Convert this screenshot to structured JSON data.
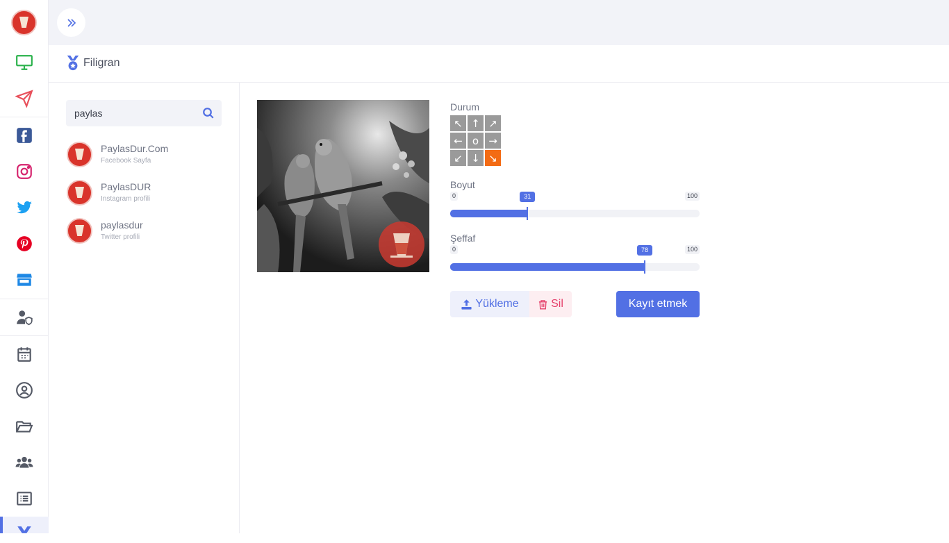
{
  "header": {
    "page_title": "Filigran"
  },
  "search": {
    "value": "paylas",
    "placeholder": ""
  },
  "accounts": [
    {
      "name": "PaylasDur.Com",
      "type": "Facebook Sayfa"
    },
    {
      "name": "PaylasDUR",
      "type": "Instagram profili"
    },
    {
      "name": "paylasdur",
      "type": "Twitter profili"
    }
  ],
  "controls": {
    "position_label": "Durum",
    "position_grid": [
      "↖",
      "↑",
      "↗",
      "←",
      "o",
      "→",
      "↙",
      "↓",
      "↘"
    ],
    "selected_position": "bottom-right",
    "size_label": "Boyut",
    "size": {
      "min": "0",
      "max": "100",
      "value": "31"
    },
    "opacity_label": "Şeffaf",
    "opacity": {
      "min": "0",
      "max": "100",
      "value": "78"
    }
  },
  "buttons": {
    "upload": "Yükleme",
    "delete": "Sil",
    "save": "Kayıt etmek"
  },
  "sidebar_icons": [
    "monitor-icon",
    "paper-plane-icon",
    "facebook-icon",
    "instagram-icon",
    "twitter-icon",
    "pinterest-icon",
    "store-icon",
    "user-shield-icon",
    "calendar-icon",
    "user-circle-icon",
    "folder-open-icon",
    "users-icon",
    "list-icon",
    "watermark-icon"
  ],
  "colors": {
    "accent": "#5270e4",
    "active_cell": "#f36b14",
    "delete": "#e5406b"
  }
}
